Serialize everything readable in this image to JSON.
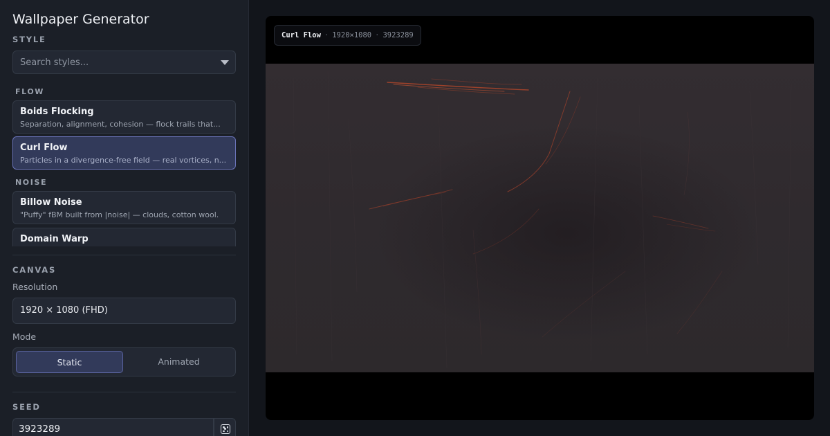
{
  "app": {
    "title": "Wallpaper Generator"
  },
  "style_section": {
    "label": "STYLE",
    "search_placeholder": "Search styles...",
    "groups": [
      {
        "label": "FLOW",
        "items": [
          {
            "name": "Boids Flocking",
            "description": "Separation, alignment, cohesion — flock trails that...",
            "selected": false
          },
          {
            "name": "Curl Flow",
            "description": "Particles in a divergence-free field — real vortices, n...",
            "selected": true
          }
        ]
      },
      {
        "label": "NOISE",
        "items": [
          {
            "name": "Billow Noise",
            "description": "\"Puffy\" fBM built from |noise| — clouds, cotton wool.",
            "selected": false
          },
          {
            "name": "Domain Warp",
            "description": "",
            "selected": false
          }
        ]
      }
    ]
  },
  "canvas_section": {
    "label": "CANVAS",
    "resolution_label": "Resolution",
    "resolution_value": "1920 × 1080 (FHD)",
    "mode_label": "Mode",
    "modes": [
      "Static",
      "Animated"
    ],
    "active_mode": "Static"
  },
  "seed_section": {
    "label": "SEED",
    "value": "3923289",
    "randomize_icon": "dice-icon"
  },
  "preview": {
    "style_name": "Curl Flow",
    "resolution": "1920×1080",
    "seed": "3923289",
    "separator": "·"
  },
  "colors": {
    "accent": "#323a5a",
    "accent_border": "#6a73b8",
    "sidebar_bg": "#1b1f27",
    "wallpaper_base": "#302a2e",
    "streak": "#b0452c"
  }
}
